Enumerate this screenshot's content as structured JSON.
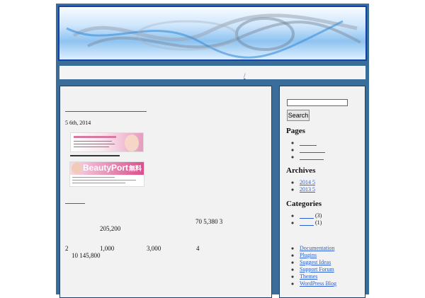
{
  "nav": {
    "links": [
      " ",
      " ",
      " / "
    ]
  },
  "post": {
    "title": "",
    "date": "5   6th, 2014",
    "more": "",
    "lines": [
      {
        "text": "70    5,380          3"
      },
      {
        "text": "205,200"
      },
      {
        "text": "2"
      },
      {
        "text": "1,000"
      },
      {
        "text": "3,000"
      },
      {
        "text": "4"
      },
      {
        "text": "10    145,800"
      }
    ],
    "image1_alt": "banner",
    "image2_brand": "BeautyPort",
    "image2_badge": "無料",
    "colors": {
      "pink": "#d94f8d",
      "link": "#2a5fd6",
      "frame": "#3a6d9a"
    }
  },
  "sidebar": {
    "search_button": "Search",
    "search_value": "",
    "pages_title": "Pages",
    "archives_title": "Archives",
    "archives": [
      "2014   5",
      "2013   5"
    ],
    "categories_title": "Categories",
    "categories": [
      {
        "label": "",
        "count": "(3)"
      },
      {
        "label": "",
        "count": "(1)"
      }
    ],
    "meta_links": [
      "Documentation",
      "Plugins",
      "Suggest Ideas",
      "Support Forum",
      "Themes",
      "WordPress Blog"
    ]
  }
}
